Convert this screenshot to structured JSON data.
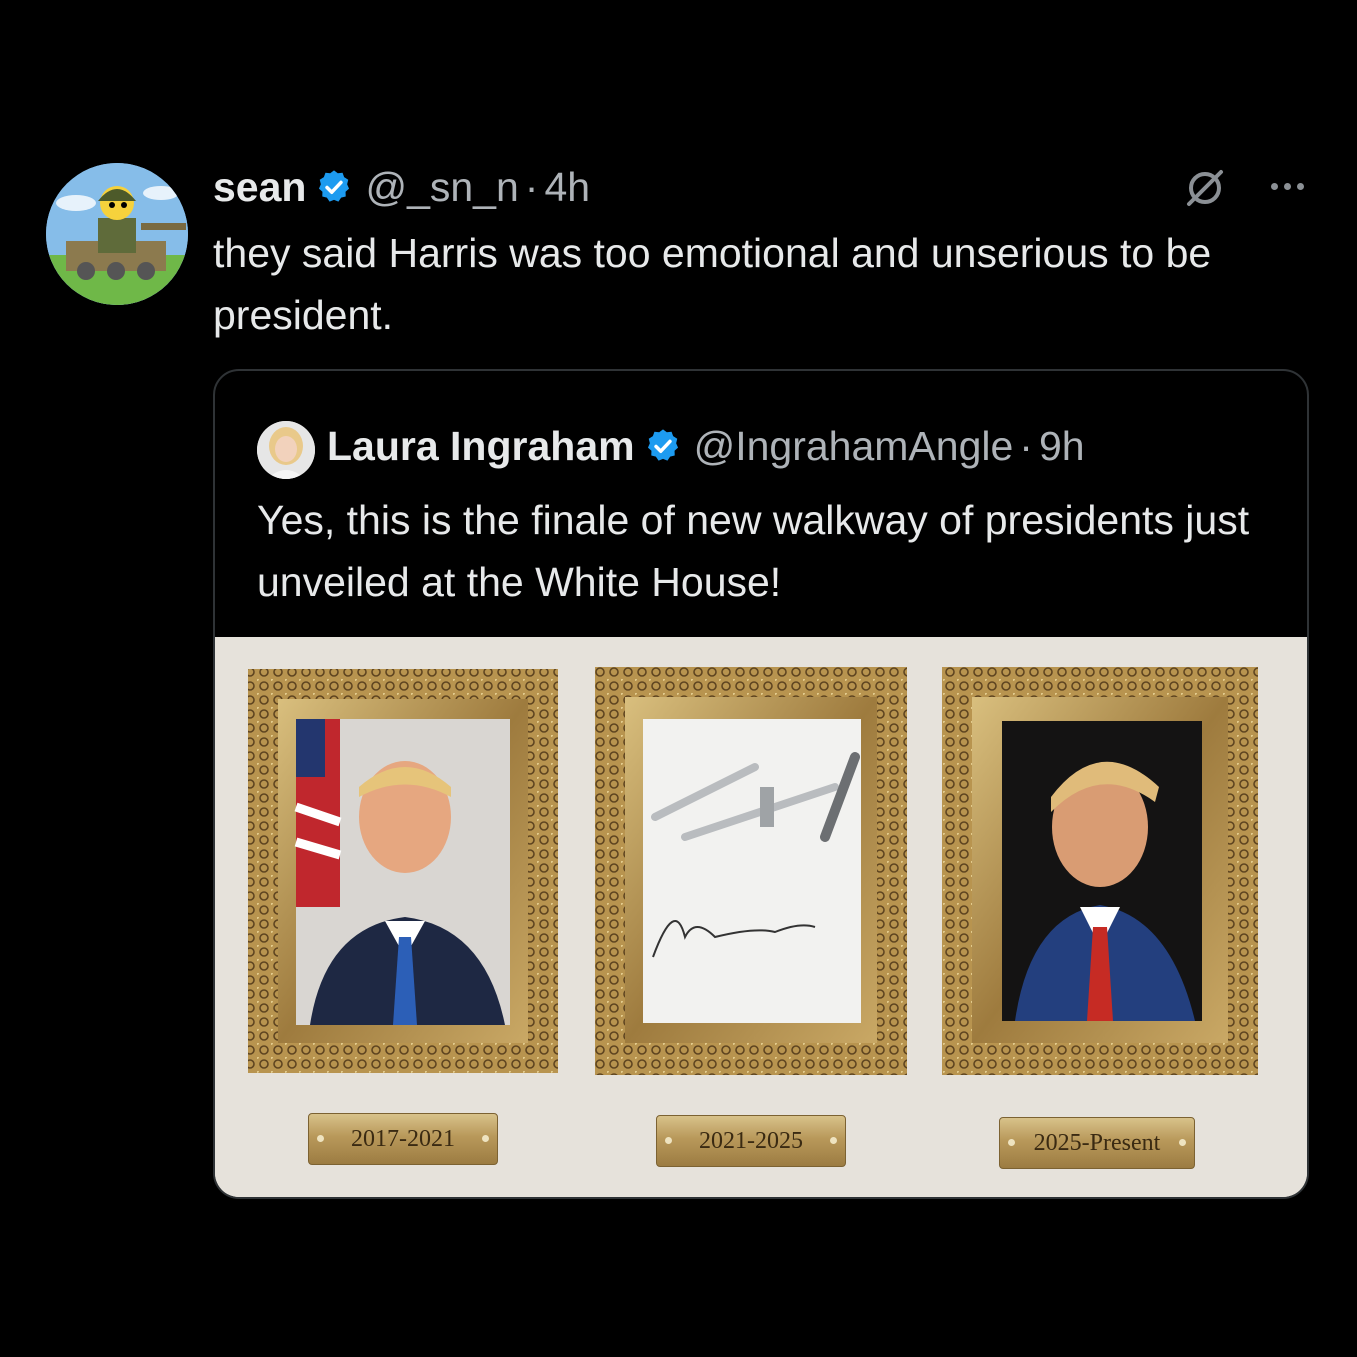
{
  "tweet": {
    "name": "sean",
    "handle": "@_sn_n",
    "separator": "·",
    "time": "4h",
    "text": "they said Harris was too emotional and unserious to be president."
  },
  "quoted_tweet": {
    "name": "Laura Ingraham",
    "handle": "@IngrahamAngle",
    "separator": "·",
    "time": "9h",
    "text": "Yes, this is the finale of new walkway of presidents just unveiled at the White House!"
  },
  "image": {
    "plaques": [
      "2017-2021",
      "2021-2025",
      "2025-Present"
    ]
  },
  "icons": {
    "verified": "verified-badge-icon",
    "grok": "grok-icon",
    "more": "more-options-icon"
  },
  "colors": {
    "background": "#000000",
    "text": "#e7e9ea",
    "secondary_text": "#aeb3b8",
    "verified_blue": "#1d9bf0",
    "border": "#2f3336"
  }
}
